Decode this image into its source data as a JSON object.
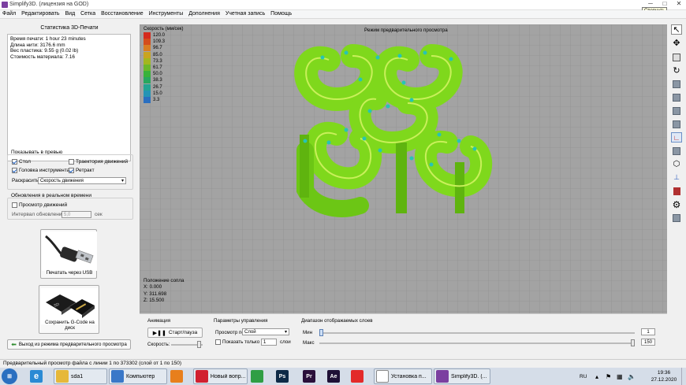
{
  "window": {
    "title": "Simplify3D. (лицензия на GOD)",
    "tooltip": "Свернуть"
  },
  "menu": [
    "Файл",
    "Редактировать",
    "Вид",
    "Сетка",
    "Восстановление",
    "Инструменты",
    "Дополнения",
    "Учетная запись",
    "Помощь"
  ],
  "stats": {
    "heading": "Статистика 3D-Печати",
    "lines": [
      "Время печати: 1 hour 23 minutes",
      "Длина нити: 3176.6 mm",
      "Вес пластика: 9.55 g (0.02 lb)",
      "Стоимость материала: 7.16"
    ]
  },
  "preview_options": {
    "heading": "Показывать в превью",
    "bed_label": "Стол",
    "bed_checked": true,
    "travel_label": "Траектория движений",
    "travel_checked": false,
    "toolhead_label": "Головка инструмента",
    "toolhead_checked": true,
    "retract_label": "Ретракт",
    "retract_checked": true,
    "color_label": "Раскрасить",
    "color_value": "Скорость движения"
  },
  "realtime": {
    "heading": "Обновления в реальном времени",
    "motion_label": "Просмотр движений",
    "motion_checked": false,
    "interval_label": "Интервал обновления",
    "interval_value": "5,0",
    "interval_unit": "сек"
  },
  "buttons": {
    "usb_label": "Печатать через USB",
    "sd_label": "Сохранить G-Code на диск",
    "exit_preview_label": "Выход из режима предварительного просмотра"
  },
  "viewport": {
    "mode_label": "Режим предварительного просмотра",
    "legend_title": "Скорость (мм/сек)",
    "legend": [
      {
        "value": "120.0",
        "color": "#d42a1e"
      },
      {
        "value": "109.3",
        "color": "#d44d1c"
      },
      {
        "value": "96.7",
        "color": "#d97d22"
      },
      {
        "value": "85.0",
        "color": "#c9a41f"
      },
      {
        "value": "73.3",
        "color": "#a3b61f"
      },
      {
        "value": "61.7",
        "color": "#6cb82a"
      },
      {
        "value": "50.0",
        "color": "#38b23a"
      },
      {
        "value": "38.3",
        "color": "#27a85e"
      },
      {
        "value": "26.7",
        "color": "#23a592"
      },
      {
        "value": "15.0",
        "color": "#2494b5"
      },
      {
        "value": "3.3",
        "color": "#2a6fc0"
      }
    ],
    "nozzle_heading": "Положение сопла",
    "nozzle_x": "X: 0.000",
    "nozzle_y": "Y: 311.698",
    "nozzle_z": "Z: 15.500"
  },
  "animation": {
    "heading": "Анимация",
    "play_label": "Старт/пауза",
    "speed_label": "Скорость:",
    "speed_level": 0.95
  },
  "control": {
    "heading": "Параметры управления",
    "view_by_label": "Просмотр по",
    "view_by_value": "Слой",
    "show_only_label": "Показать только",
    "show_only_value": "1",
    "show_only_unit": "слои",
    "show_only_checked": false
  },
  "layers": {
    "heading": "Диапазон отображаемых слоев",
    "min_label": "Мин",
    "min_value": "1",
    "max_label": "Макс",
    "max_value": "150",
    "min_level": 0.0,
    "max_level": 1.0
  },
  "status": "Предварительный просмотр файла с линии 1 по 373302 (слой от 1 по 150)",
  "taskbar": {
    "items": [
      {
        "label": "sda1",
        "icon": "folder-icon",
        "color": "#e6b83a"
      },
      {
        "label": "Компьютер",
        "icon": "computer-icon",
        "color": "#3a78c8"
      },
      {
        "label": "",
        "icon": "media-player-icon",
        "color": "#e87f1c"
      },
      {
        "label": "Новый вопр...",
        "icon": "opera-icon",
        "color": "#d12030"
      },
      {
        "label": "",
        "icon": "chrome-icon",
        "color": "#2f9e44"
      },
      {
        "label": "Ps",
        "icon": "photoshop-icon",
        "color": "#0e2a47"
      },
      {
        "label": "Pr",
        "icon": "premiere-icon",
        "color": "#2a0f3a"
      },
      {
        "label": "Ae",
        "icon": "aftereffects-icon",
        "color": "#1f1036"
      },
      {
        "label": "",
        "icon": "yandex-icon",
        "color": "#e32a2a"
      },
      {
        "label": "Установка п...",
        "icon": "document-icon",
        "color": "#ffffff"
      },
      {
        "label": "Simplify3D. (...",
        "icon": "simplify3d-icon",
        "color": "#7b3fa0"
      }
    ],
    "lang": "RU",
    "time": "19:36",
    "date": "27.12.2020"
  }
}
